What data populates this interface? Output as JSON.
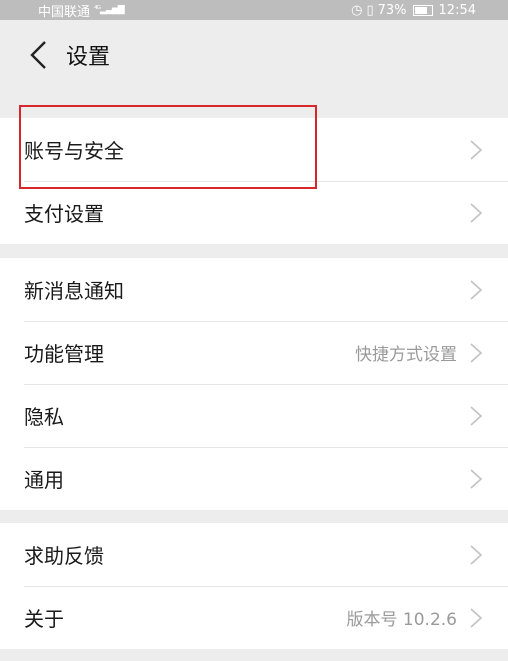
{
  "status_bar": {
    "carrier": "中国联通",
    "signal_text": "4G",
    "battery_percent": "73%",
    "time": "12:54"
  },
  "header": {
    "title": "设置",
    "back_icon": "back-chevron-icon"
  },
  "groups": [
    {
      "items": [
        {
          "label": "账号与安全",
          "value": ""
        },
        {
          "label": "支付设置",
          "value": ""
        }
      ]
    },
    {
      "items": [
        {
          "label": "新消息通知",
          "value": ""
        },
        {
          "label": "功能管理",
          "value": "快捷方式设置"
        },
        {
          "label": "隐私",
          "value": ""
        },
        {
          "label": "通用",
          "value": ""
        }
      ]
    },
    {
      "items": [
        {
          "label": "求助反馈",
          "value": ""
        },
        {
          "label": "关于",
          "value": "版本号 10.2.6"
        }
      ]
    }
  ],
  "colors": {
    "background": "#ededed",
    "row_background": "#ffffff",
    "highlight": "#d7262c",
    "secondary_text": "#9a9a9a"
  }
}
